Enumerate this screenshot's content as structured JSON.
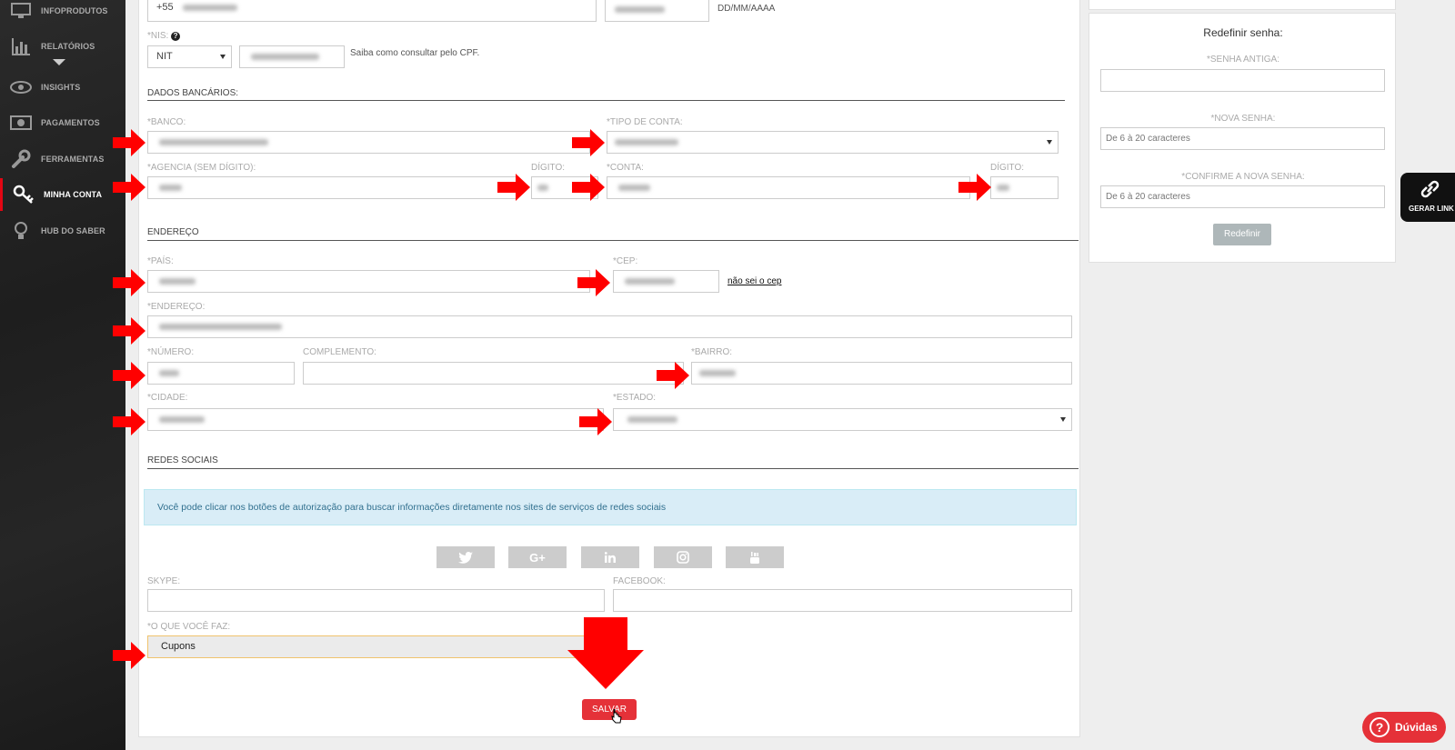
{
  "sidebar": {
    "items": [
      {
        "label": "INFOPRODUTOS",
        "icon": "monitor-icon"
      },
      {
        "label": "RELATÓRIOS",
        "icon": "bar-chart-icon"
      },
      {
        "label": "INSIGHTS",
        "icon": "eye-icon"
      },
      {
        "label": "PAGAMENTOS",
        "icon": "money-icon"
      },
      {
        "label": "FERRAMENTAS",
        "icon": "wrench-icon"
      },
      {
        "label": "MINHA CONTA",
        "icon": "key-icon",
        "active": true
      },
      {
        "label": "HUB DO SABER",
        "icon": "lightbulb-icon"
      }
    ],
    "accent": "#e30613"
  },
  "personal": {
    "phone_prefix": "+55",
    "date_hint": "DD/MM/AAAA",
    "nis_label": "*NIS:",
    "nis_type": "NIT",
    "nis_hint": "Saiba como consultar pelo CPF."
  },
  "bank": {
    "section_title": "DADOS BANCÁRIOS:",
    "banco_label": "*BANCO:",
    "tipo_conta_label": "*TIPO DE CONTA:",
    "agencia_label": "*AGENCIA (SEM DÍGITO):",
    "agencia_digito_label": "DÍGITO:",
    "conta_label": "*CONTA:",
    "conta_digito_label": "DÍGITO:"
  },
  "address": {
    "section_title": "ENDEREÇO",
    "pais_label": "*PAÍS:",
    "cep_label": "*CEP:",
    "cep_link": "não sei o cep",
    "endereco_label": "*ENDEREÇO:",
    "numero_label": "*NÚMERO:",
    "complemento_label": "COMPLEMENTO:",
    "bairro_label": "*BAIRRO:",
    "cidade_label": "*CIDADE:",
    "estado_label": "*ESTADO:"
  },
  "social": {
    "section_title": "REDES SOCIAIS",
    "info": "Você pode clicar nos botões de autorização para buscar informações diretamente nos sites de serviços de redes sociais",
    "buttons": [
      "twitter-icon",
      "google-plus-icon",
      "linkedin-icon",
      "instagram-icon",
      "youtube-icon"
    ],
    "google_plus_text": "G+",
    "skype_label": "SKYPE:",
    "facebook_label": "FACEBOOK:",
    "oque_label": "*O QUE VOCÊ FAZ:",
    "oque_value": "Cupons"
  },
  "save_label": "SALVAR",
  "password": {
    "title": "Redefinir senha:",
    "old_label": "*SENHA ANTIGA:",
    "new_label": "*NOVA SENHA:",
    "new_placeholder": "De 6 à 20 caracteres",
    "confirm_label": "*CONFIRME A NOVA SENHA:",
    "confirm_placeholder": "De 6 à 20 caracteres",
    "button": "Redefinir"
  },
  "gerar_link_label": "GERAR LINK",
  "duvidas_label": "Dúvidas",
  "colors": {
    "arrow": "#ff0000",
    "button_red": "#e53138",
    "info_bg": "#d9edf7"
  }
}
